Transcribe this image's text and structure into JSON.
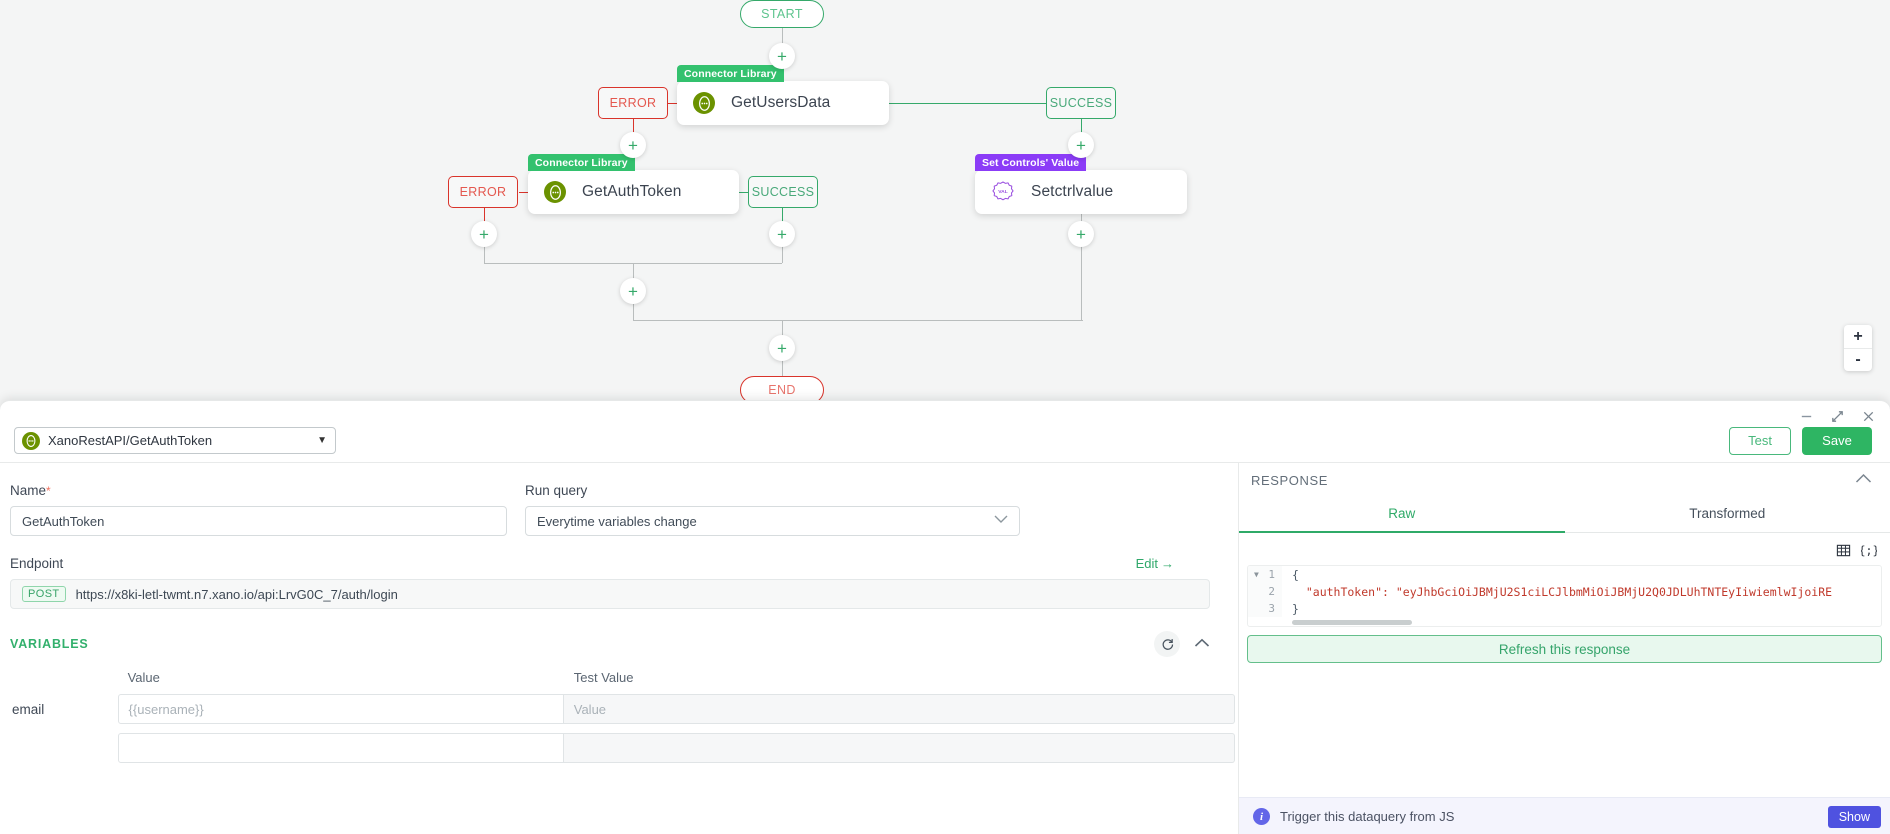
{
  "canvas": {
    "start_label": "START",
    "end_label": "END",
    "add_label": "+",
    "nodes": [
      {
        "badge": "Connector Library",
        "label": "GetUsersData",
        "icon": "api-connector-icon",
        "badge_color": "#33c16e"
      },
      {
        "badge": "Connector Library",
        "label": "GetAuthToken",
        "icon": "api-connector-icon",
        "badge_color": "#33c16e"
      },
      {
        "badge": "Set Controls' Value",
        "label": "Setctrlvalue",
        "icon": "val-icon",
        "badge_color": "#8b3cf7"
      }
    ],
    "chips": {
      "error": "ERROR",
      "success": "SUCCESS"
    },
    "zoom": {
      "in": "+",
      "out": "-"
    }
  },
  "window_controls": {
    "minimize": "minimize-icon",
    "expand": "expand-icon",
    "close": "close-icon"
  },
  "toolbar": {
    "dataquery_selected": "XanoRestAPI/GetAuthToken",
    "dataquery_icon": "api-connector-icon",
    "caret": "⌄",
    "test_label": "Test",
    "save_label": "Save"
  },
  "form": {
    "name_label": "Name",
    "name_required": "*",
    "name_value": "GetAuthToken",
    "run_query_label": "Run query",
    "run_query_value": "Everytime variables change",
    "endpoint_label": "Endpoint",
    "endpoint_method": "POST",
    "endpoint_url": "https://x8ki-letl-twmt.n7.xano.io/api:LrvG0C_7/auth/login",
    "edit_label": "Edit",
    "edit_arrow": "→",
    "variables_title": "VARIABLES",
    "columns": [
      "Value",
      "Test Value"
    ],
    "rows": [
      {
        "name": "email",
        "value_placeholder": "{{username}}",
        "test_placeholder": "Value"
      },
      {
        "name": "",
        "value_placeholder": "",
        "test_placeholder": ""
      }
    ]
  },
  "response": {
    "title": "RESPONSE",
    "collapse_icon": "chevron-up-icon",
    "tabs": [
      {
        "label": "Raw",
        "active": true
      },
      {
        "label": "Transformed",
        "active": false
      }
    ],
    "view_toggle": [
      "table-view-icon",
      "json-view-icon"
    ],
    "code_lines": [
      {
        "num": "1",
        "text": "{",
        "fold": true
      },
      {
        "num": "2",
        "text": "  \"authToken\": \"eyJhbGciOiJBMjU2S1ciLCJlbmMiOiJBMjU2Q0JDLUhTNTEyIiwiemlwIjoiRE",
        "fold": false
      },
      {
        "num": "3",
        "text": "}",
        "fold": false
      }
    ],
    "refresh_label": "Refresh this response",
    "js_hint": "Trigger this dataquery from JS",
    "js_show_label": "Show"
  },
  "colors": {
    "green": "#2eb563",
    "red": "#d9342b",
    "purple": "#8b3cf7",
    "indigo": "#4f52e0"
  }
}
